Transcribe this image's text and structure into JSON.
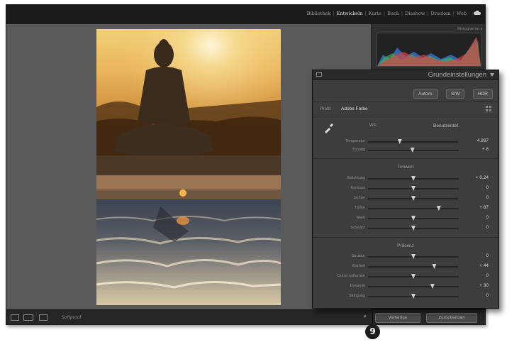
{
  "modules": {
    "items": [
      "Bibliothek",
      "Entwickeln",
      "Karte",
      "Buch",
      "Diashow",
      "Drucken",
      "Web"
    ],
    "active_index": 1,
    "separator": "|"
  },
  "histogram": {
    "label": "Histogramm ◂"
  },
  "toolbar": {
    "label": "Softproof",
    "arrow": "▾",
    "button_prev": "Vorherige",
    "button_reset": "Zurücksetzen"
  },
  "panel": {
    "title": "Grundeinstellungen",
    "buttons": [
      "Autom.",
      "S/W",
      "HDR"
    ],
    "profile_label": "Profil:",
    "profile_value": "Adobe Farbe",
    "wb_label": "WA:",
    "wb_value": "Benutzerdef.",
    "sections": {
      "tone": "Tonwert",
      "presence": "Präsenz"
    },
    "wb_sliders": [
      {
        "label": "Temperatur",
        "pos": 0.35,
        "value": "4.937"
      },
      {
        "label": "Tönung",
        "pos": 0.49,
        "value": "+ 8"
      }
    ],
    "tone_sliders": [
      {
        "label": "Belichtung",
        "pos": 0.5,
        "value": "+ 0,24"
      },
      {
        "label": "Kontrast",
        "pos": 0.5,
        "value": "0"
      },
      {
        "label": "Lichter",
        "pos": 0.5,
        "value": "0"
      },
      {
        "label": "Tiefen",
        "pos": 0.78,
        "value": "+ 87"
      },
      {
        "label": "Weiß",
        "pos": 0.5,
        "value": "0"
      },
      {
        "label": "Schwarz",
        "pos": 0.5,
        "value": "0"
      }
    ],
    "presence_sliders": [
      {
        "label": "Struktur",
        "pos": 0.5,
        "value": "0"
      },
      {
        "label": "Klarheit",
        "pos": 0.73,
        "value": "+ 44"
      },
      {
        "label": "Dunst entfernen",
        "pos": 0.5,
        "value": "0"
      },
      {
        "label": "Dynamik",
        "pos": 0.71,
        "value": "+ 30"
      },
      {
        "label": "Sättigung",
        "pos": 0.5,
        "value": "0"
      }
    ]
  },
  "callout": {
    "number": "9"
  },
  "colors": {
    "accent_sunset": "#e8a03a",
    "panel_bg": "#3d3d3d",
    "app_bg": "#5a5a5a"
  }
}
